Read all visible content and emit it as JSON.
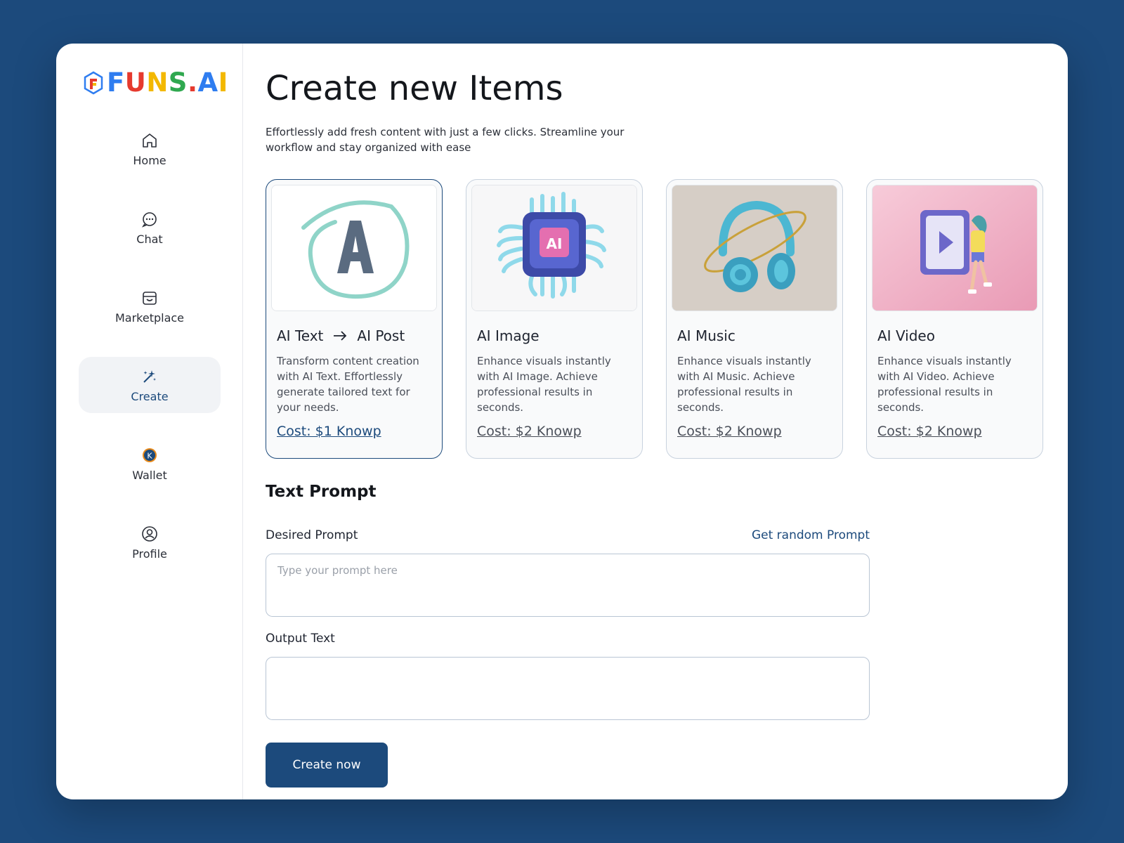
{
  "brand": {
    "logo_text": "FUNS.AI"
  },
  "sidebar": {
    "items": [
      {
        "label": "Home",
        "icon": "home-icon"
      },
      {
        "label": "Chat",
        "icon": "chat-icon"
      },
      {
        "label": "Marketplace",
        "icon": "store-icon"
      },
      {
        "label": "Create",
        "icon": "magic-wand-icon",
        "active": true
      },
      {
        "label": "Wallet",
        "icon": "wallet-coin-icon"
      },
      {
        "label": "Profile",
        "icon": "profile-icon"
      }
    ]
  },
  "page": {
    "title": "Create new Items",
    "subtitle": "Effortlessly add fresh content with just a few clicks. Streamline your workflow and stay organized with ease"
  },
  "cards": [
    {
      "title_a": "AI Text",
      "title_b": "AI Post",
      "desc": "Transform content creation with AI Text. Effortlessly generate tailored text for your needs.",
      "cost": "Cost: $1 Knowp",
      "selected": true
    },
    {
      "title": "AI Image",
      "desc": "Enhance visuals instantly with AI Image. Achieve professional results in seconds.",
      "cost": "Cost: $2 Knowp"
    },
    {
      "title": "AI Music",
      "desc": "Enhance visuals instantly with AI Music. Achieve professional results in seconds.",
      "cost": "Cost: $2 Knowp"
    },
    {
      "title": "AI Video",
      "desc": "Enhance visuals instantly with AI Video. Achieve professional results in seconds.",
      "cost": "Cost: $2 Knowp"
    }
  ],
  "form": {
    "section_title": "Text Prompt",
    "prompt_label": "Desired Prompt",
    "random_link": "Get random Prompt",
    "prompt_placeholder": "Type your prompt here",
    "output_label": "Output Text",
    "submit_label": "Create now"
  },
  "colors": {
    "accent": "#1c4a7c",
    "background": "#1c4a7c",
    "card_bg": "#f9fafb"
  }
}
